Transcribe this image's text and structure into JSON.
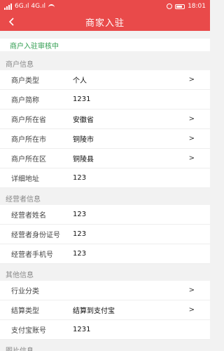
{
  "status_bar": {
    "left_text": "6G.ıl 4G.ıl",
    "time": "18:01",
    "signal_icon": "signal-icon",
    "wifi_icon": "wifi-icon",
    "alarm_icon": "alarm-icon",
    "battery_icon": "battery-icon"
  },
  "header": {
    "title": "商家入驻",
    "back_icon": "chevron-left-icon"
  },
  "banner": {
    "text": "商户入驻审核中"
  },
  "sections": [
    {
      "title": "商户信息",
      "rows": [
        {
          "label": "商户类型",
          "value": "个人",
          "chevron": ">"
        },
        {
          "label": "商户简称",
          "value": "1231",
          "chevron": ""
        },
        {
          "label": "商户所在省",
          "value": "安徽省",
          "chevron": ">"
        },
        {
          "label": "商户所在市",
          "value": "铜陵市",
          "chevron": ">"
        },
        {
          "label": "商户所在区",
          "value": "铜陵县",
          "chevron": ">"
        },
        {
          "label": "详细地址",
          "value": "123",
          "chevron": ""
        }
      ]
    },
    {
      "title": "经营者信息",
      "rows": [
        {
          "label": "经营者姓名",
          "value": "123",
          "chevron": ""
        },
        {
          "label": "经营者身份证号",
          "value": "123",
          "chevron": ""
        },
        {
          "label": "经营者手机号",
          "value": "123",
          "chevron": ""
        }
      ]
    },
    {
      "title": "其他信息",
      "rows": [
        {
          "label": "行业分类",
          "value": "",
          "chevron": ">"
        },
        {
          "label": "结算类型",
          "value": "结算到支付宝",
          "chevron": ">"
        },
        {
          "label": "支付宝账号",
          "value": "1231",
          "chevron": ""
        }
      ]
    },
    {
      "title": "图片信息",
      "rows": []
    }
  ],
  "colors": {
    "brand_red": "#e94a4a",
    "status_green": "#2e9c4e",
    "background": "#f2f2f2"
  }
}
